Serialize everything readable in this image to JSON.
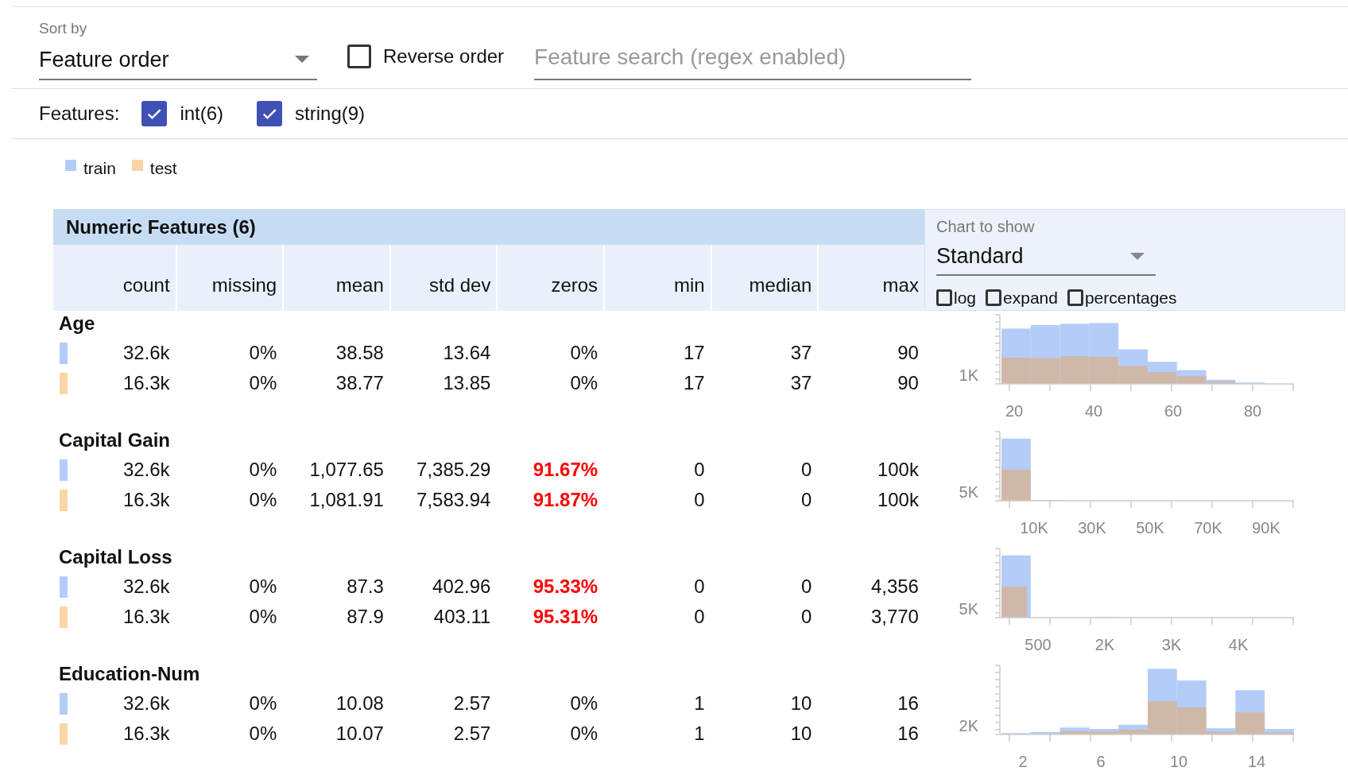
{
  "sort": {
    "label": "Sort by",
    "value": "Feature order"
  },
  "reverse": {
    "label": "Reverse order",
    "checked": false
  },
  "search": {
    "placeholder": "Feature search (regex enabled)"
  },
  "features_filter": {
    "label": "Features:",
    "items": [
      {
        "label": "int(6)",
        "checked": true
      },
      {
        "label": "string(9)",
        "checked": true
      }
    ]
  },
  "legend": [
    {
      "label": "train",
      "color": "#b3cdf8"
    },
    {
      "label": "test",
      "color": "#fbd5a4"
    }
  ],
  "table": {
    "title": "Numeric Features (6)",
    "columns": [
      "count",
      "missing",
      "mean",
      "std dev",
      "zeros",
      "min",
      "median",
      "max"
    ],
    "chart_panel": {
      "label": "Chart to show",
      "value": "Standard",
      "options": [
        {
          "label": "log",
          "checked": false
        },
        {
          "label": "expand",
          "checked": false
        },
        {
          "label": "percentages",
          "checked": false
        }
      ]
    },
    "features": [
      {
        "name": "Age",
        "chart": {
          "y_label": "1K",
          "x_labels": [
            "20",
            "40",
            "60",
            "80"
          ]
        },
        "rows": [
          {
            "color": "#b3cdf8",
            "zeros_alert": false,
            "values": [
              "32.6k",
              "0%",
              "38.58",
              "13.64",
              "0%",
              "17",
              "37",
              "90"
            ]
          },
          {
            "color": "#fbd5a4",
            "zeros_alert": false,
            "values": [
              "16.3k",
              "0%",
              "38.77",
              "13.85",
              "0%",
              "17",
              "37",
              "90"
            ]
          }
        ]
      },
      {
        "name": "Capital Gain",
        "chart": {
          "y_label": "5K",
          "x_labels": [
            "10K",
            "30K",
            "50K",
            "70K",
            "90K"
          ]
        },
        "rows": [
          {
            "color": "#b3cdf8",
            "zeros_alert": true,
            "values": [
              "32.6k",
              "0%",
              "1,077.65",
              "7,385.29",
              "91.67%",
              "0",
              "0",
              "100k"
            ]
          },
          {
            "color": "#fbd5a4",
            "zeros_alert": true,
            "values": [
              "16.3k",
              "0%",
              "1,081.91",
              "7,583.94",
              "91.87%",
              "0",
              "0",
              "100k"
            ]
          }
        ]
      },
      {
        "name": "Capital Loss",
        "chart": {
          "y_label": "5K",
          "x_labels": [
            "500",
            "2K",
            "3K",
            "4K"
          ]
        },
        "rows": [
          {
            "color": "#b3cdf8",
            "zeros_alert": true,
            "values": [
              "32.6k",
              "0%",
              "87.3",
              "402.96",
              "95.33%",
              "0",
              "0",
              "4,356"
            ]
          },
          {
            "color": "#fbd5a4",
            "zeros_alert": true,
            "values": [
              "16.3k",
              "0%",
              "87.9",
              "403.11",
              "95.31%",
              "0",
              "0",
              "3,770"
            ]
          }
        ]
      },
      {
        "name": "Education-Num",
        "chart": {
          "y_label": "2K",
          "x_labels": [
            "2",
            "6",
            "10",
            "14"
          ]
        },
        "rows": [
          {
            "color": "#b3cdf8",
            "zeros_alert": false,
            "values": [
              "32.6k",
              "0%",
              "10.08",
              "2.57",
              "0%",
              "1",
              "10",
              "16"
            ]
          },
          {
            "color": "#fbd5a4",
            "zeros_alert": false,
            "values": [
              "16.3k",
              "0%",
              "10.07",
              "2.57",
              "0%",
              "1",
              "10",
              "16"
            ]
          }
        ]
      }
    ]
  }
}
